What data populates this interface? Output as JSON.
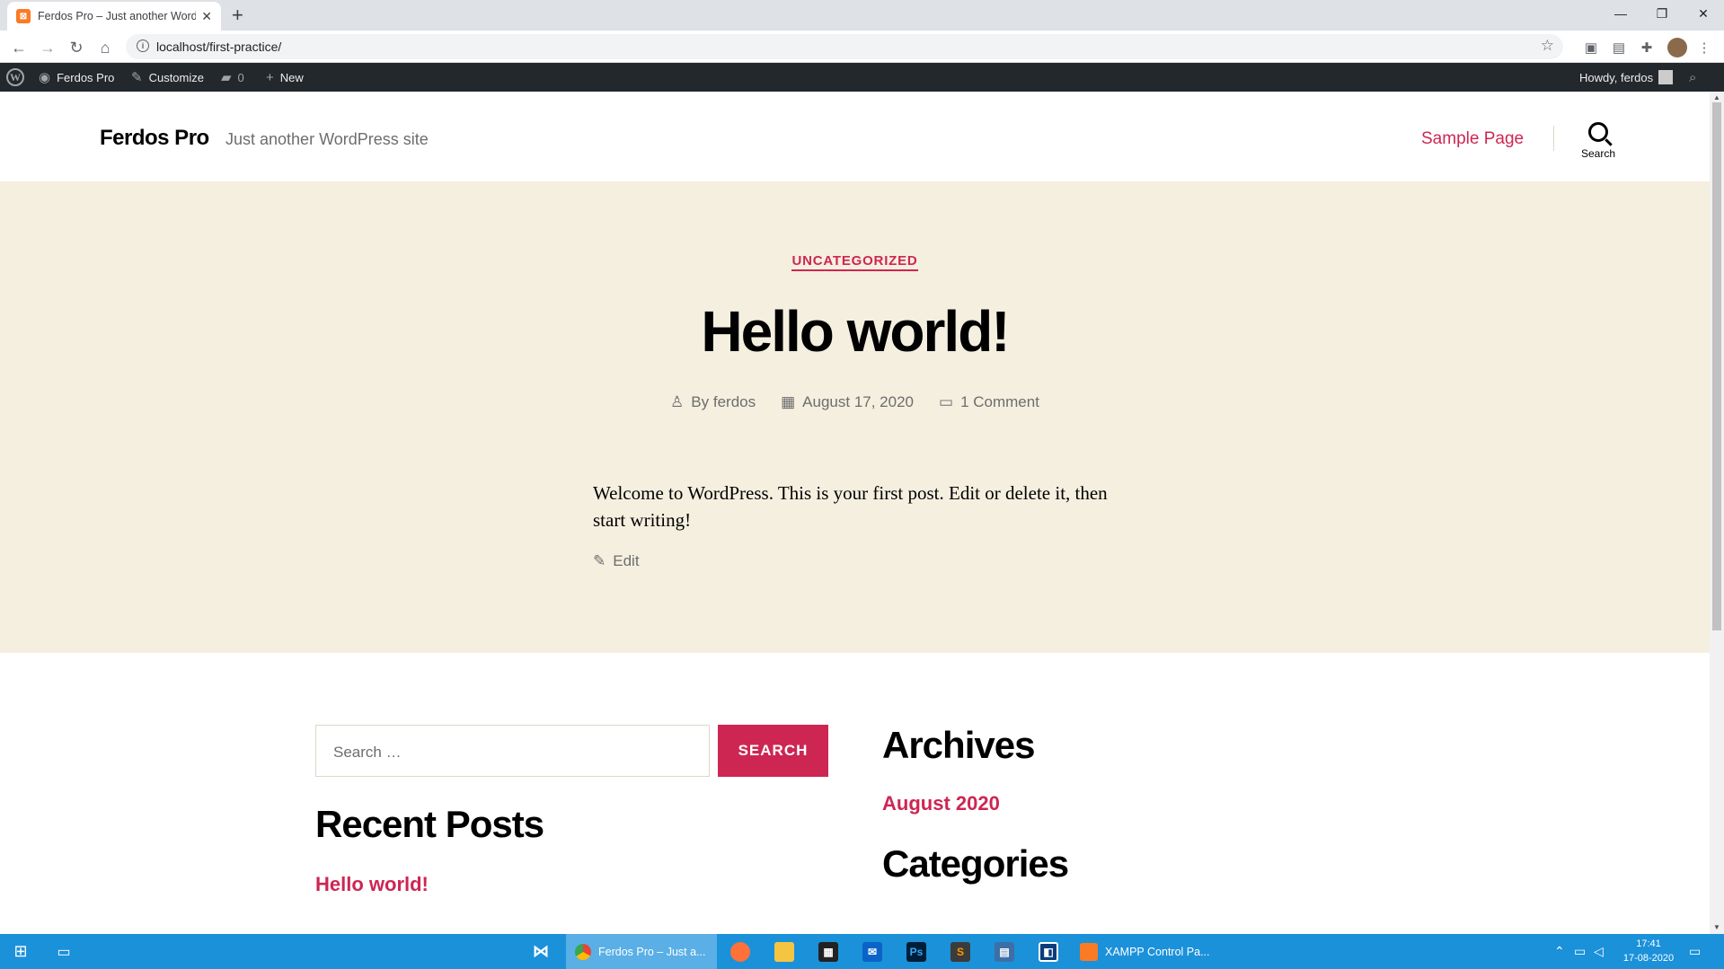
{
  "browser": {
    "tab_title": "Ferdos Pro – Just another WordPress site",
    "tab_favicon": "xampp-icon",
    "url": "localhost/first-practice/"
  },
  "admin_bar": {
    "site_name": "Ferdos Pro",
    "customize": "Customize",
    "comments_count": "0",
    "new_label": "New",
    "howdy": "Howdy, ferdos"
  },
  "site": {
    "title": "Ferdos Pro",
    "description": "Just another WordPress site",
    "menu_item": "Sample Page",
    "search_label": "Search"
  },
  "post": {
    "category": "UNCATEGORIZED",
    "title": "Hello world!",
    "author": "By ferdos",
    "date": "August 17, 2020",
    "comments": "1 Comment",
    "content": "Welcome to WordPress. This is your first post. Edit or delete it, then start writing!",
    "edit_label": "Edit"
  },
  "widgets": {
    "search_placeholder": "Search …",
    "search_button": "SEARCH",
    "recent_posts_title": "Recent Posts",
    "recent_posts": [
      "Hello world!"
    ],
    "archives_title": "Archives",
    "archives": [
      "August 2020"
    ],
    "categories_title": "Categories"
  },
  "taskbar": {
    "chrome_task": "Ferdos Pro – Just a...",
    "xampp_task": "XAMPP Control Pa...",
    "time": "17:41",
    "date": "17-08-2020"
  },
  "colors": {
    "accent": "#cd2653",
    "hero_bg": "#f5efe0",
    "admin_bar": "#23282d",
    "taskbar": "#1b91d9"
  }
}
